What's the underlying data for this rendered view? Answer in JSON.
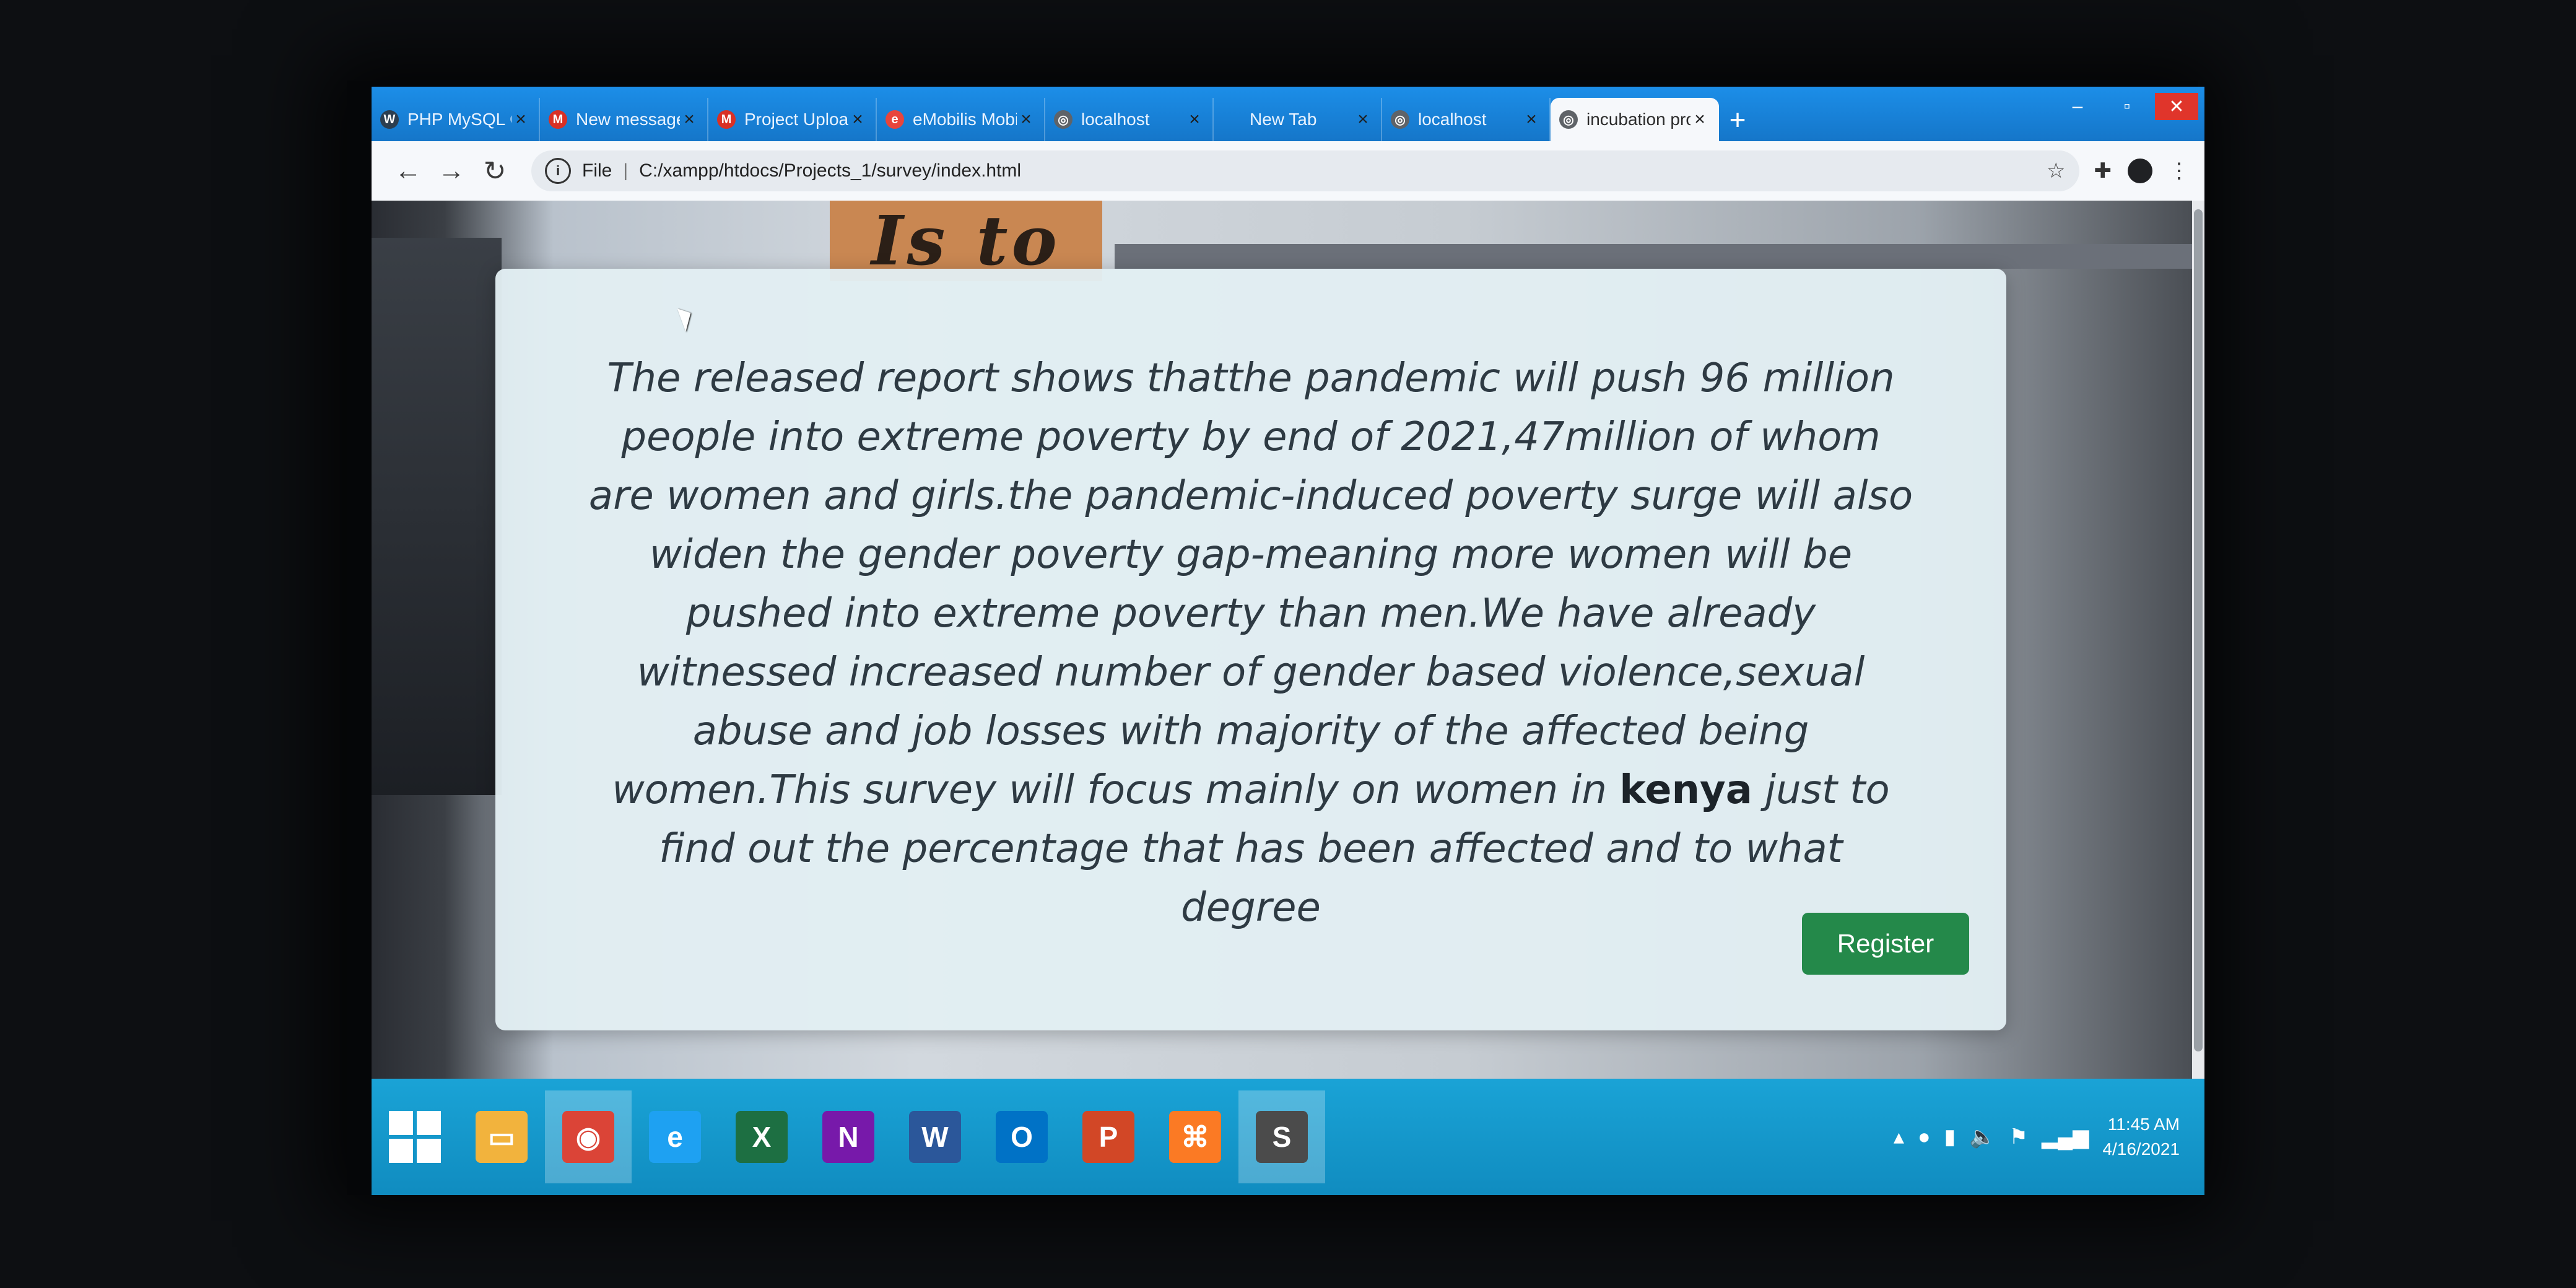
{
  "browser": {
    "tabs": [
      {
        "label": "PHP MySQL Cr",
        "icon": "w3schools-icon",
        "color": "#2c3e50",
        "glyph": "W"
      },
      {
        "label": "New message",
        "icon": "gmail-icon",
        "color": "#d93025",
        "glyph": "M"
      },
      {
        "label": "Project Upload",
        "icon": "gmail-icon",
        "color": "#d93025",
        "glyph": "M"
      },
      {
        "label": "eMobilis Mobi",
        "icon": "emobilis-icon",
        "color": "#e8453c",
        "glyph": "e"
      },
      {
        "label": "localhost",
        "icon": "globe-icon",
        "color": "#5f6368",
        "glyph": "◎"
      },
      {
        "label": "New Tab",
        "icon": "",
        "color": "transparent",
        "glyph": ""
      },
      {
        "label": "localhost",
        "icon": "globe-icon",
        "color": "#5f6368",
        "glyph": "◎"
      },
      {
        "label": "incubation pro",
        "icon": "globe-icon",
        "color": "#5f6368",
        "glyph": "◎",
        "active": true
      }
    ],
    "new_tab": "+",
    "address": {
      "scheme": "File",
      "url": "C:/xampp/htdocs/Projects_1/survey/index.html"
    }
  },
  "page": {
    "sign_text": "Is to Speak",
    "paragraph_before": "The released report shows thatthe pandemic will push 96 million people into extreme poverty by end of 2021,47million of whom are women and girls.the pandemic-induced poverty surge will also widen the gender poverty gap-meaning more women will be pushed into extreme poverty than men.We have already witnessed increased number of gender based violence,sexual abuse and job losses with majority of the affected being women.This survey will focus mainly on women in",
    "emphasis": "kenya",
    "paragraph_after": " just to find out the percentage that has been affected and to what degree",
    "register_label": "Register"
  },
  "taskbar": {
    "apps": [
      {
        "name": "file-explorer-icon",
        "color": "#f2b33d",
        "glyph": "▭"
      },
      {
        "name": "chrome-icon",
        "color": "#db4437",
        "glyph": "◉",
        "active": true
      },
      {
        "name": "internet-explorer-icon",
        "color": "#1ea1f2",
        "glyph": "e"
      },
      {
        "name": "excel-icon",
        "color": "#1d6f42",
        "glyph": "X"
      },
      {
        "name": "onenote-icon",
        "color": "#7719aa",
        "glyph": "N"
      },
      {
        "name": "word-icon",
        "color": "#2b579a",
        "glyph": "W"
      },
      {
        "name": "outlook-icon",
        "color": "#0072c6",
        "glyph": "O"
      },
      {
        "name": "powerpoint-icon",
        "color": "#d24726",
        "glyph": "P"
      },
      {
        "name": "xampp-icon",
        "color": "#fb7a24",
        "glyph": "⌘"
      },
      {
        "name": "sublime-text-icon",
        "color": "#4b4b4b",
        "glyph": "S",
        "active": true
      }
    ],
    "time": "11:45 AM",
    "date": "4/16/2021"
  }
}
